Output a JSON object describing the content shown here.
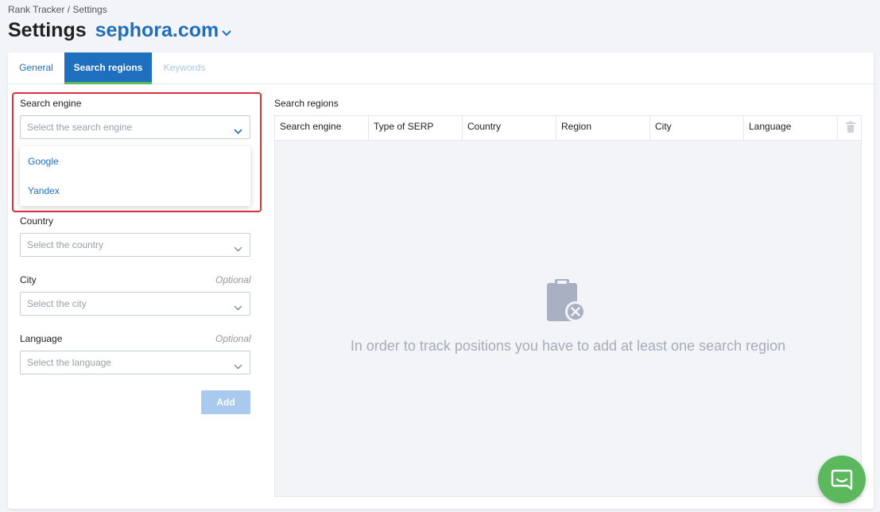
{
  "header": {
    "breadcrumb": "Rank Tracker / Settings",
    "title": "Settings",
    "site": "sephora.com",
    "accent_color": "#1f6fbf"
  },
  "tabs": [
    {
      "label": "General",
      "state": "normal"
    },
    {
      "label": "Search regions",
      "state": "active"
    },
    {
      "label": "Keywords",
      "state": "disabled"
    }
  ],
  "form": {
    "search_engine": {
      "label": "Search engine",
      "placeholder": "Select the search engine",
      "open": true,
      "options": [
        "Google",
        "Yandex"
      ]
    },
    "country": {
      "label": "Country",
      "placeholder": "Select the country"
    },
    "city": {
      "label": "City",
      "optional": "Optional",
      "placeholder": "Select the city"
    },
    "language": {
      "label": "Language",
      "optional": "Optional",
      "placeholder": "Select the language"
    },
    "add_label": "Add"
  },
  "regions": {
    "title": "Search regions",
    "columns": [
      "Search engine",
      "Type of SERP",
      "Country",
      "Region",
      "City",
      "Language"
    ],
    "empty_icon": "clipboard-x-icon",
    "empty_text": "In order to track positions you have to add at least one search region"
  },
  "chat": {
    "icon": "chat-icon",
    "color": "#5cb85c"
  }
}
